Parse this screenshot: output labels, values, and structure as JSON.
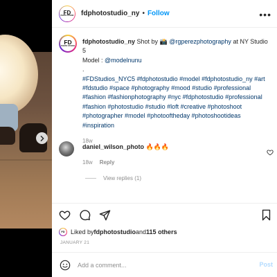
{
  "post": {
    "username": "fdphotostudio_ny",
    "follow_label": "Follow",
    "avatar_text_big": "FD",
    "avatar_text_small": "PHOTO STUDIO",
    "more_icon": "more-dots-icon"
  },
  "caption": {
    "username": "fdphotostudio_ny",
    "line1_text": " Shot by 📸 ",
    "photographer": "@rgperezphotography",
    "line1_tail": " at NY Studio 5",
    "model_label": "Model : ",
    "model": "@modelnunu",
    "dot": ".",
    "hashtags": "#FDStudios_NYC5 #fdphotostudio #model #fdphotostudio_ny #art #fdstudio #space #photography #mood #studio #professional #fashion #fashionphotography #nyc #fdphotostudio #professional #fashion #photostudio #studio #loft #creative #photoshoot #photographer #model #photooftheday #photoshootideas #inspiration",
    "time": "18w"
  },
  "comment": {
    "username": "daniel_wilson_photo",
    "text": " 🔥🔥🔥",
    "time": "18w",
    "reply_label": "Reply",
    "view_replies": "View replies (1)"
  },
  "likes": {
    "prefix": "Liked by ",
    "user": "fdphotostudio",
    "middle": " and ",
    "others": "115 others"
  },
  "date": "JANUARY 21",
  "add_comment": {
    "placeholder": "Add a comment...",
    "post_label": "Post"
  },
  "colors": {
    "link": "#00376b",
    "follow": "#0095f6",
    "muted": "#8e8e8e"
  }
}
